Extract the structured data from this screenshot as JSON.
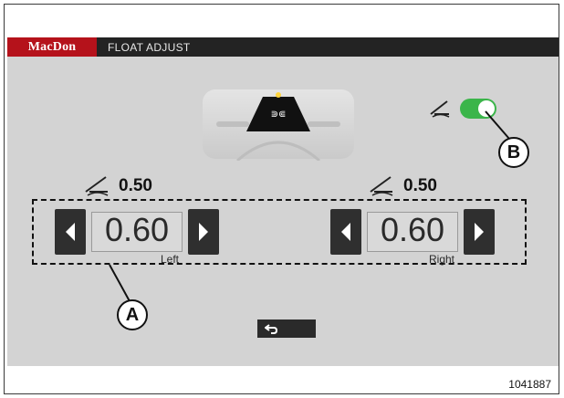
{
  "header": {
    "brand": "MacDon",
    "title": "FLOAT ADJUST"
  },
  "float_toggle": {
    "icon": "float-icon",
    "on": true,
    "accent_color": "#3bb54a"
  },
  "left": {
    "setpoint": "0.50",
    "value": "0.60",
    "label": "Left"
  },
  "right": {
    "setpoint": "0.50",
    "value": "0.60",
    "label": "Right"
  },
  "callouts": {
    "a": "A",
    "b": "B"
  },
  "back": {
    "icon": "back-icon"
  },
  "figure_number": "1041887",
  "colors": {
    "brand_red": "#b5121b",
    "bar_dark": "#232323",
    "panel_gray": "#d3d3d3"
  }
}
